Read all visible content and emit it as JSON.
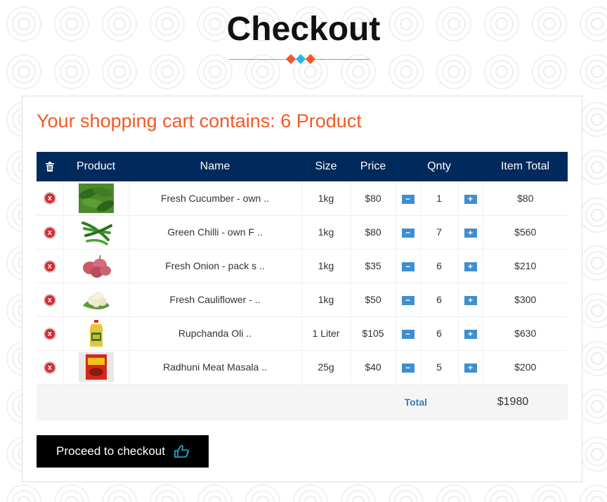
{
  "page": {
    "title": "Checkout"
  },
  "colors": {
    "accent_orange": "#f05a28",
    "accent_blue": "#29b6e8",
    "header_navy": "#002a5c",
    "remove_red": "#e3262e",
    "qty_button_blue": "#3d8fd1"
  },
  "cart": {
    "heading": "Your shopping cart contains: 6 Product",
    "columns": {
      "remove": "",
      "product": "Product",
      "name": "Name",
      "size": "Size",
      "price": "Price",
      "qnty": "Qnty",
      "item_total": "Item Total"
    },
    "items": [
      {
        "name": "Fresh Cucumber - own ..",
        "size": "1kg",
        "price": "$80",
        "qty": "1",
        "total": "$80",
        "image": "cucumber"
      },
      {
        "name": "Green Chilli - own F ..",
        "size": "1kg",
        "price": "$80",
        "qty": "7",
        "total": "$560",
        "image": "green-chilli"
      },
      {
        "name": "Fresh Onion - pack s ..",
        "size": "1kg",
        "price": "$35",
        "qty": "6",
        "total": "$210",
        "image": "onion"
      },
      {
        "name": "Fresh Cauliflower - ..",
        "size": "1kg",
        "price": "$50",
        "qty": "6",
        "total": "$300",
        "image": "cauliflower"
      },
      {
        "name": "Rupchanda Oli ..",
        "size": "1 Liter",
        "price": "$105",
        "qty": "6",
        "total": "$630",
        "image": "oil-bottle"
      },
      {
        "name": "Radhuni Meat Masala ..",
        "size": "25g",
        "price": "$40",
        "qty": "5",
        "total": "$200",
        "image": "masala-pack"
      }
    ],
    "total_label": "Total",
    "total_value": "$1980",
    "remove_glyph": "x",
    "minus_glyph": "−",
    "plus_glyph": "+"
  },
  "checkout_button": {
    "label": "Proceed to checkout",
    "icon": "hand-pointing-icon"
  }
}
